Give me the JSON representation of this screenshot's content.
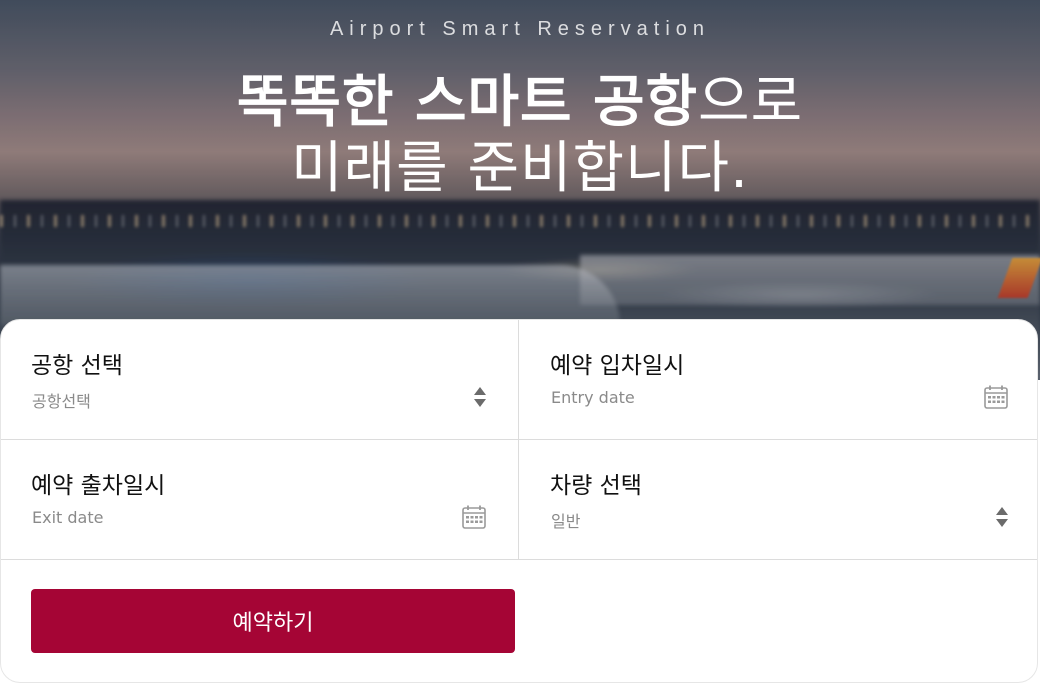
{
  "hero": {
    "eyebrow": "Airport Smart Reservation",
    "headline_bold": "똑똑한 스마트 공항",
    "headline_light": "으로",
    "headline_line2": "미래를 준비합니다."
  },
  "form": {
    "airport": {
      "label": "공항 선택",
      "value": "공항선택",
      "icon": "sort-icon"
    },
    "entry": {
      "label": "예약 입차일시",
      "placeholder": "Entry date",
      "icon": "calendar-icon"
    },
    "exit": {
      "label": "예약 출차일시",
      "placeholder": "Exit date",
      "icon": "calendar-icon"
    },
    "vehicle": {
      "label": "차량 선택",
      "value": "일반",
      "icon": "sort-icon"
    },
    "submit_label": "예약하기"
  },
  "colors": {
    "accent": "#a50535",
    "label_text": "#111111",
    "placeholder_text": "#8a8a8a",
    "divider": "#dcdcdc"
  }
}
